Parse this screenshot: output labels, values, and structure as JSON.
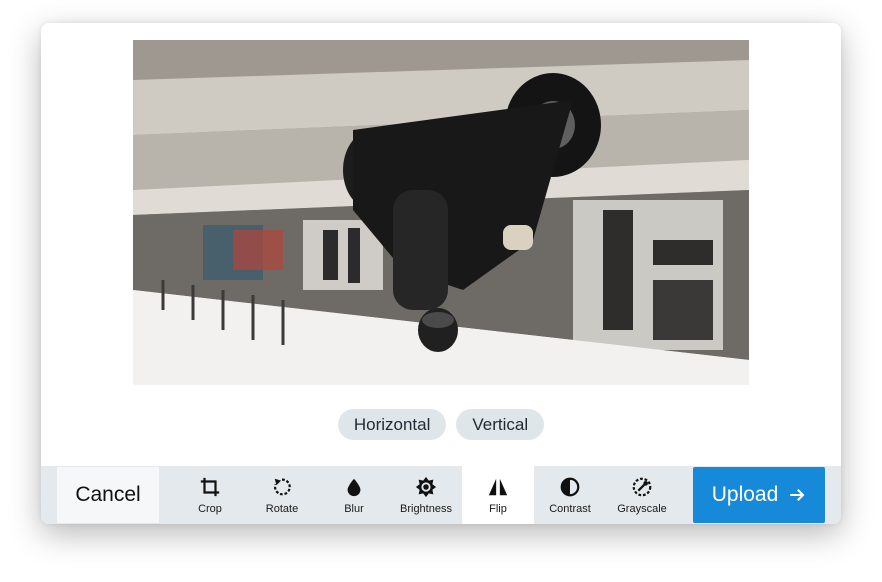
{
  "flip_options": [
    {
      "label": "Horizontal"
    },
    {
      "label": "Vertical"
    }
  ],
  "toolbar": {
    "cancel_label": "Cancel",
    "upload_label": "Upload",
    "active_tool": "Flip",
    "tools": [
      {
        "label": "Crop",
        "icon": "crop-icon"
      },
      {
        "label": "Rotate",
        "icon": "rotate-icon"
      },
      {
        "label": "Blur",
        "icon": "blur-icon"
      },
      {
        "label": "Brightness",
        "icon": "brightness-icon"
      },
      {
        "label": "Flip",
        "icon": "flip-icon"
      },
      {
        "label": "Contrast",
        "icon": "contrast-icon"
      },
      {
        "label": "Grayscale",
        "icon": "grayscale-icon"
      }
    ]
  },
  "colors": {
    "accent": "#1689d9",
    "toolbar_bg": "#e3e9ec",
    "chip_bg": "#dfe6ea"
  }
}
